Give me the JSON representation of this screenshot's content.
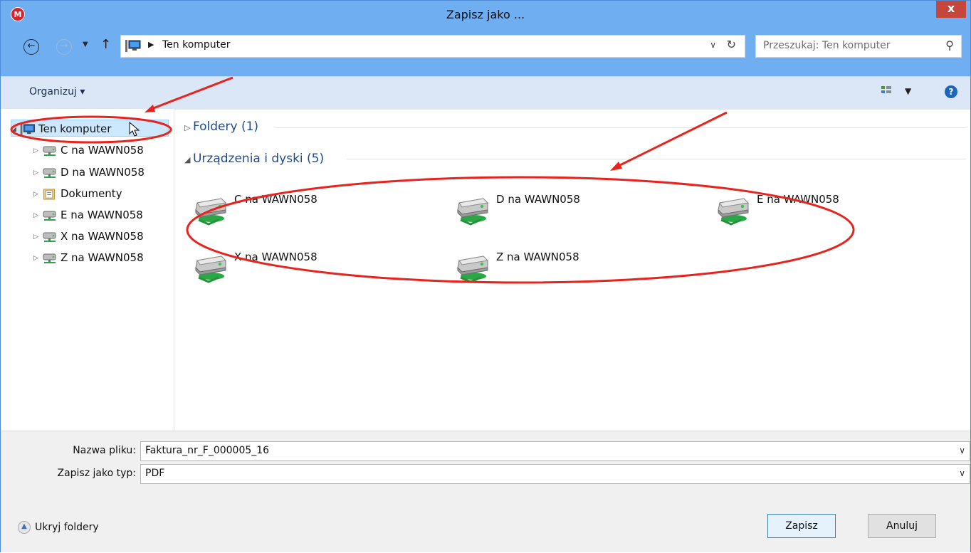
{
  "window": {
    "title": "Zapisz jako ...",
    "app_icon_letter": "M",
    "close_label": "x"
  },
  "nav": {
    "back_icon": "back-arrow-icon",
    "forward_icon": "forward-arrow-icon",
    "recent_icon": "chevron-down-icon",
    "up_icon": "up-arrow-icon",
    "address_path": "Ten komputer",
    "search_placeholder": "Przeszukaj: Ten komputer"
  },
  "toolbar": {
    "organize_label": "Organizuj ▾"
  },
  "tree": {
    "items": [
      {
        "label": "Ten komputer",
        "icon": "computer-icon",
        "expanded": true,
        "selected": true
      },
      {
        "label": "C na WAWN058",
        "icon": "network-drive-icon"
      },
      {
        "label": "D na WAWN058",
        "icon": "network-drive-icon"
      },
      {
        "label": "Dokumenty",
        "icon": "documents-folder-icon"
      },
      {
        "label": "E na WAWN058",
        "icon": "network-drive-icon"
      },
      {
        "label": "X na WAWN058",
        "icon": "network-drive-icon"
      },
      {
        "label": "Z na WAWN058",
        "icon": "network-drive-icon"
      }
    ]
  },
  "content": {
    "groups": [
      {
        "label": "Foldery (1)",
        "expanded": false
      },
      {
        "label": "Urządzenia i dyski (5)",
        "expanded": true
      }
    ],
    "drives": [
      {
        "label": "C na WAWN058",
        "icon": "network-drive-icon"
      },
      {
        "label": "D na WAWN058",
        "icon": "network-drive-icon"
      },
      {
        "label": "E na WAWN058",
        "icon": "network-drive-icon"
      },
      {
        "label": "X na WAWN058",
        "icon": "network-drive-icon"
      },
      {
        "label": "Z na WAWN058",
        "icon": "network-drive-icon"
      }
    ]
  },
  "form": {
    "filename_label": "Nazwa pliku:",
    "filename_value": "Faktura_nr_F_000005_16",
    "filetype_label": "Zapisz jako typ:",
    "filetype_value": "PDF"
  },
  "footer": {
    "hide_folders_label": "Ukryj foldery",
    "save_label": "Zapisz",
    "cancel_label": "Anuluj"
  },
  "colors": {
    "titlebar": "#70aef2",
    "toolbar": "#dbe7f6",
    "annotation": "#e8231e",
    "group_header": "#1e4b8c"
  }
}
